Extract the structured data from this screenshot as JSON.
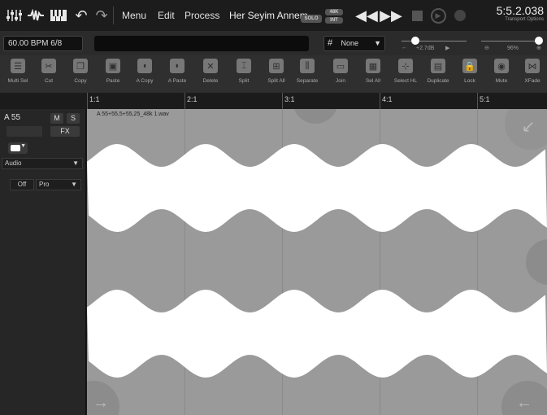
{
  "topbar": {
    "menu": [
      "Menu",
      "Edit",
      "Process"
    ],
    "song_title": "Her Seyim Annem",
    "badge_solo": "SOLO",
    "badge_48k": "48K",
    "badge_int": "INT",
    "time": "5:5.2.038",
    "time_sub": "Transport Options"
  },
  "bar2": {
    "bpm": "60.00 BPM   6/8",
    "grid_value": "None",
    "gain": "+2.7dB",
    "zoom": "96%"
  },
  "toolbar": [
    {
      "name": "multi-sel",
      "label": "Multi Sel"
    },
    {
      "name": "cut",
      "label": "Cut"
    },
    {
      "name": "copy",
      "label": "Copy"
    },
    {
      "name": "paste",
      "label": "Paste"
    },
    {
      "name": "a-copy",
      "label": "A Copy"
    },
    {
      "name": "a-paste",
      "label": "A Paste"
    },
    {
      "name": "delete",
      "label": "Delete"
    },
    {
      "name": "split",
      "label": "Split"
    },
    {
      "name": "split-all",
      "label": "Split All"
    },
    {
      "name": "separate",
      "label": "Separate"
    },
    {
      "name": "join",
      "label": "Join"
    },
    {
      "name": "sel-all",
      "label": "Sel All"
    },
    {
      "name": "select-hl",
      "label": "Select HL"
    },
    {
      "name": "duplicate",
      "label": "Duplicate"
    },
    {
      "name": "lock",
      "label": "Lock"
    },
    {
      "name": "mute",
      "label": "Mute"
    },
    {
      "name": "xfade",
      "label": "XFade"
    }
  ],
  "ruler": [
    "1:1",
    "2:1",
    "3:1",
    "4:1",
    "5:1"
  ],
  "track": {
    "name": "A 55",
    "mute": "M",
    "solo": "S",
    "fx": "FX",
    "type": "Audio",
    "off": "Off",
    "pro": "Pro"
  },
  "clip": {
    "label": "A 55+55,5+55,25_48k 1.wav"
  },
  "colors": {
    "waveform": "#ffffff",
    "clip_bg": "#9a9a9a",
    "toolbar_bg": "#2f2f2f"
  }
}
